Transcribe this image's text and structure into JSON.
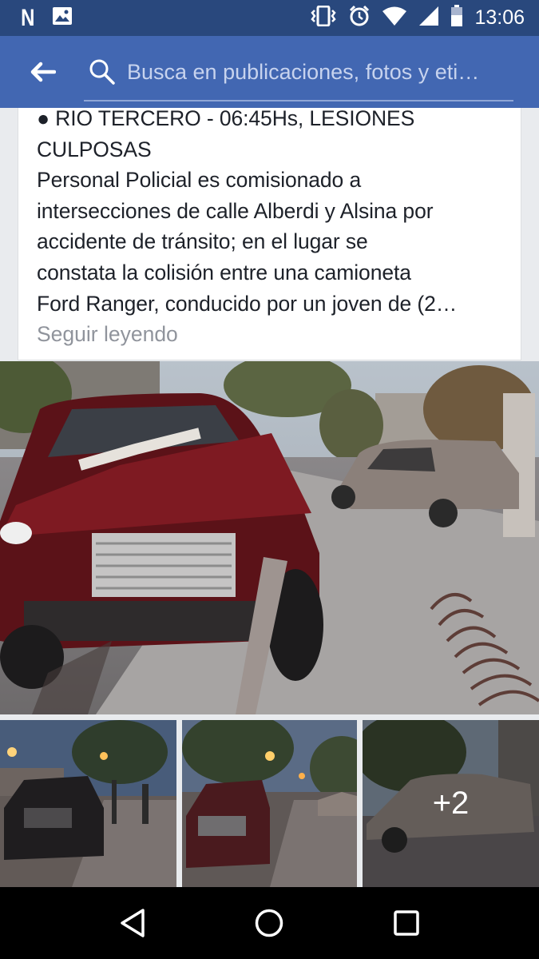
{
  "status_bar": {
    "time": "13:06",
    "left_icons": [
      "netflix-icon",
      "gallery-icon"
    ],
    "right_icons": [
      "vibrate-icon",
      "alarm-icon",
      "wifi-icon",
      "signal-icon",
      "battery-icon"
    ]
  },
  "search": {
    "placeholder": "Busca en publicaciones, fotos y eti…",
    "back_icon": "back-arrow-icon",
    "search_icon": "search-icon"
  },
  "post": {
    "lines": [
      "● RIO TERCERO - 06:45Hs, LESIONES",
      "CULPOSAS",
      "Personal Policial es comisionado a",
      "intersecciones de calle Alberdi y Alsina por",
      "accidente de tránsito; en el lugar se",
      "constata la colisión entre una camioneta",
      "Ford Ranger, conducido por un joven de (2…"
    ],
    "see_more": "Seguir leyendo"
  },
  "photos": {
    "more_count": "+2"
  },
  "nav_bar": {
    "icons": [
      "back-triangle-icon",
      "home-circle-icon",
      "recents-square-icon"
    ]
  }
}
